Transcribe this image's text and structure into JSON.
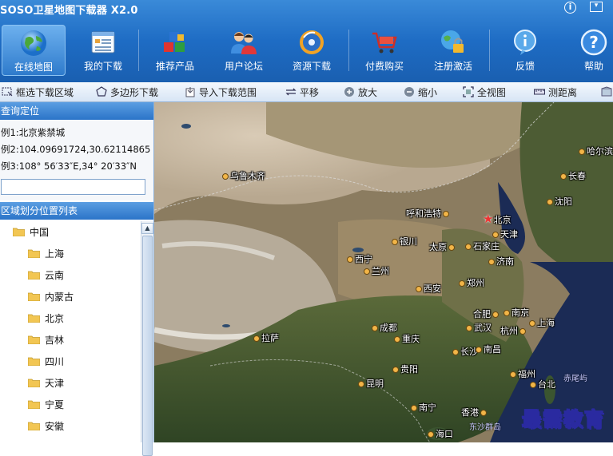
{
  "window": {
    "title": "SOSO卫星地图下载器 X2.0",
    "info_glyph": "i",
    "menu_glyph": "▾"
  },
  "nav": [
    {
      "label": "在线地图",
      "icon": "globe-icon"
    },
    {
      "label": "我的下载",
      "icon": "document-list-icon"
    },
    {
      "label": "推荐产品",
      "icon": "cubes-icon"
    },
    {
      "label": "用户论坛",
      "icon": "users-icon"
    },
    {
      "label": "资源下载",
      "icon": "disc-icon"
    },
    {
      "label": "付费购买",
      "icon": "cart-icon"
    },
    {
      "label": "注册激活",
      "icon": "lock-globe-icon"
    },
    {
      "label": "反馈",
      "icon": "info-bubble-icon"
    },
    {
      "label": "帮助",
      "icon": "help-icon"
    }
  ],
  "tools": [
    {
      "label": "框选下载区域",
      "icon": "select-rect-icon"
    },
    {
      "label": "多边形下载",
      "icon": "polygon-icon"
    },
    {
      "label": "导入下载范围",
      "icon": "import-icon"
    },
    {
      "label": "平移",
      "icon": "pan-icon"
    },
    {
      "label": "放大",
      "icon": "zoom-in-icon"
    },
    {
      "label": "缩小",
      "icon": "zoom-out-icon"
    },
    {
      "label": "全视图",
      "icon": "full-extent-icon"
    },
    {
      "label": "测距离",
      "icon": "ruler-icon"
    }
  ],
  "query": {
    "header": "查询定位",
    "examples": [
      "例1:北京紫禁城",
      "例2:104.09691724,30.62114865",
      "例3:108° 56′33″E,34° 20′33″N"
    ],
    "search_value": ""
  },
  "regions": {
    "header": "区域划分位置列表",
    "root": "中国",
    "items": [
      "上海",
      "云南",
      "内蒙古",
      "北京",
      "吉林",
      "四川",
      "天津",
      "宁夏",
      "安徽"
    ]
  },
  "map": {
    "capital": "北京",
    "cities": [
      "哈尔滨",
      "乌鲁木齐",
      "长春",
      "沈阳",
      "呼和浩特",
      "天津",
      "银川",
      "太原",
      "石家庄",
      "西宁",
      "兰州",
      "济南",
      "西安",
      "郑州",
      "合肥",
      "南京",
      "上海",
      "拉萨",
      "成都",
      "武汉",
      "杭州",
      "重庆",
      "长沙",
      "南昌",
      "贵阳",
      "福州",
      "昆明",
      "台北",
      "南宁",
      "香港",
      "海口"
    ],
    "seas": [
      "赤尾屿",
      "东沙群岛"
    ],
    "watermark": "最需教育"
  }
}
